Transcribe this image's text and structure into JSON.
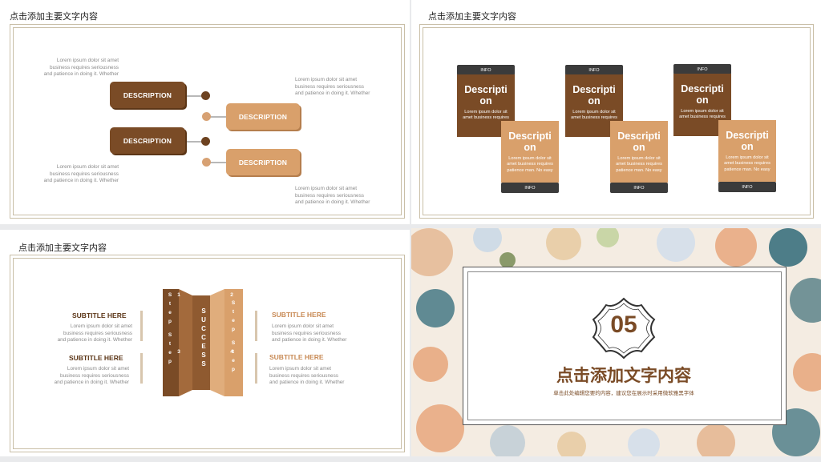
{
  "slide1": {
    "title": "点击添加主要文字内容",
    "tags": [
      "DESCRIPTION",
      "DESCRIPTION",
      "DESCRIPTION",
      "DESCRIPTION"
    ],
    "texts": [
      [
        "Lorem ipsum dolor sit amet",
        "business requires seriousness",
        "and patience in doing it. Whether"
      ],
      [
        "Lorem ipsum dolor sit amet",
        "business requires seriousness",
        "and patience in doing it. Whether"
      ],
      [
        "Lorem ipsum dolor sit amet",
        "business requires seriousness",
        "and patience in doing it. Whether"
      ],
      [
        "Lorem ipsum dolor sit amet",
        "business requires seriousness",
        "and patience in doing it. Whether"
      ]
    ]
  },
  "slide2": {
    "title": "点击添加主要文字内容",
    "cards": [
      {
        "cap": "INFO",
        "title": [
          "Descripti",
          "on"
        ],
        "text": [
          "Lorem ipsum dolor sit",
          "amet business requires"
        ]
      },
      {
        "cap": "INFO",
        "title": [
          "Descripti",
          "on"
        ],
        "text": [
          "Lorem ipsum dolor sit",
          "amet business requires",
          "patience man. No easy"
        ]
      },
      {
        "cap": "INFO",
        "title": [
          "Descripti",
          "on"
        ],
        "text": [
          "Lorem ipsum dolor sit",
          "amet business requires"
        ]
      },
      {
        "cap": "INFO",
        "title": [
          "Descripti",
          "on"
        ],
        "text": [
          "Lorem ipsum dolor sit",
          "amet business requires",
          "patience man. No easy"
        ]
      },
      {
        "cap": "INFO",
        "title": [
          "Descripti",
          "on"
        ],
        "text": [
          "Lorem ipsum dolor sit",
          "amet business requires"
        ]
      },
      {
        "cap": "INFO",
        "title": [
          "Descripti",
          "on"
        ],
        "text": [
          "Lorem ipsum dolor sit",
          "amet business requires",
          "patience man. No easy"
        ]
      }
    ]
  },
  "slide3": {
    "title": "点击添加主要文字内容",
    "subtitles": [
      "SUBTITLE HERE",
      "SUBTITLE HERE",
      "SUBTITLE HERE",
      "SUBTITLE HERE"
    ],
    "texts": [
      [
        "Lorem ipsum dolor sit amet",
        "business requires seriousness",
        "and patience in doing it. Whether"
      ],
      [
        "Lorem ipsum dolor sit amet",
        "business requires seriousness",
        "and patience in doing it. Whether"
      ],
      [
        "Lorem ipsum dolor sit amet",
        "business requires seriousness",
        "and patience in doing it. Whether"
      ],
      [
        "Lorem ipsum dolor sit amet",
        "business requires seriousness",
        "and patience in doing it. Whether"
      ]
    ],
    "step_letters": [
      "S",
      "t",
      "e",
      "p"
    ],
    "step_nums": [
      "1",
      "3",
      "2",
      "4"
    ],
    "success_letters": [
      "S",
      "U",
      "C",
      "C",
      "E",
      "S",
      "S"
    ]
  },
  "slide4": {
    "number": "05",
    "heading": "点击添加文字内容",
    "subtext": "单击此处编辑您要的内容，建议您在展示时采用微软雅黑字体"
  },
  "colors": {
    "dark_brown": "#7a4b26",
    "light_brown": "#d9a06b",
    "info_bar": "#3b3b3b"
  }
}
